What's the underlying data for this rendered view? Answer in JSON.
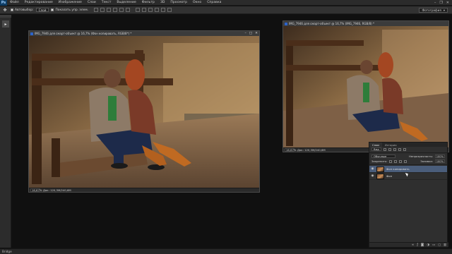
{
  "app": {
    "logo": "Ps"
  },
  "menu": [
    "Файл",
    "Редактирование",
    "Изображение",
    "Слои",
    "Текст",
    "Выделение",
    "Фильтр",
    "3D",
    "Просмотр",
    "Окно",
    "Справка"
  ],
  "window_controls": {
    "minimize": "–",
    "restore": "❐",
    "close": "✕"
  },
  "options_bar": {
    "tool_icon": "move-tool-icon",
    "auto_select_label": "Автовыбор:",
    "auto_select_value": "Слой",
    "show_transform_label": "Показать упр. элем.",
    "workspace": "Фотография"
  },
  "toolbar": {
    "tool_icon": "move-tool-icon",
    "tool_glyph": "▸"
  },
  "doc_main": {
    "title": "IMG_7946 для смарт-объект @ 16,7% (Фон копировать, RGB/8*) *",
    "zoom": "16,67%",
    "status": "Док: 120,3M/240,6M"
  },
  "doc_preview": {
    "title": "IMG_7946 для смарт-объект @ 16,7% (IMG_7946, RGB/8) *",
    "zoom": "16,67%",
    "status": "Док: 120,3M/240,6M"
  },
  "layers_panel": {
    "tabs": [
      "Слои",
      "История"
    ],
    "filter_label": "Вид",
    "blend_mode": "Обычные",
    "opacity_label": "Непрозрачность:",
    "opacity_value": "100%",
    "lock_label": "Закрепить:",
    "fill_label": "Заливка:",
    "fill_value": "100%",
    "layers": [
      {
        "name": "Фон копировать",
        "selected": true,
        "visible": true
      },
      {
        "name": "Фон",
        "selected": false,
        "visible": true
      }
    ],
    "footer_icons": [
      "link-icon",
      "fx-icon",
      "mask-icon",
      "adjustment-icon",
      "folder-icon",
      "new-layer-icon",
      "trash-icon"
    ]
  },
  "bottom_bar": {
    "label": "Bridge"
  },
  "colors": {
    "accent_selected": "#4a5d7a",
    "doc_icon": "#2d63c8"
  }
}
